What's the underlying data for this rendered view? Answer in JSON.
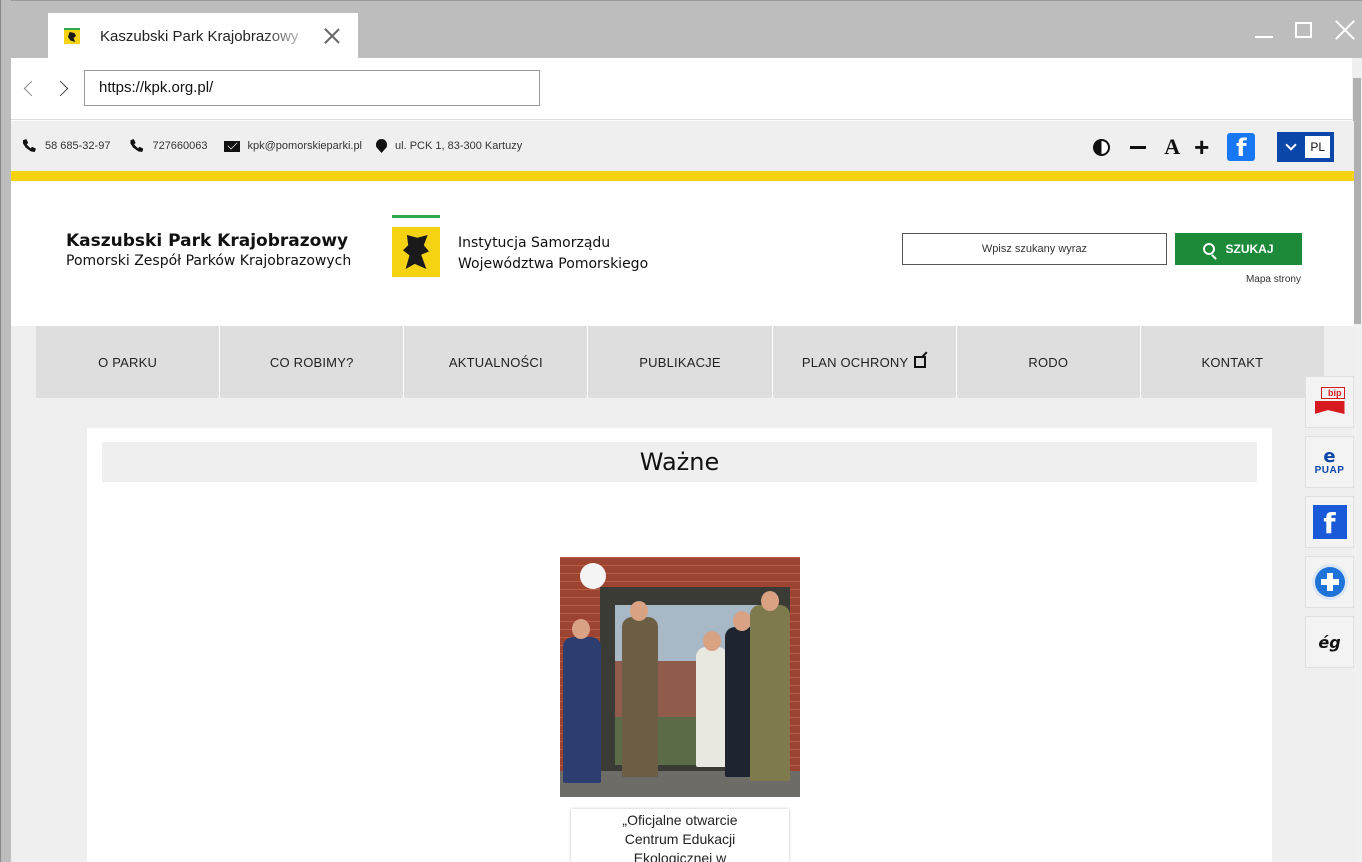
{
  "browser": {
    "tab_title": "Kaszubski Park Krajobrazowy",
    "url": "https://kpk.org.pl/"
  },
  "topbar": {
    "phone1": "58 685-32-97",
    "phone2": "727660063",
    "email": "kpk@pomorskieparki.pl",
    "address": "ul. PCK 1, 83-300 Kartuzy",
    "font_minus": "−",
    "font_a": "A",
    "font_plus": "+",
    "facebook": "f",
    "language": "PL"
  },
  "header": {
    "brand_title": "Kaszubski Park Krajobrazowy",
    "brand_subtitle": "Pomorski Zespół Parków Krajobrazowych",
    "institution_line1": "Instytucja Samorządu",
    "institution_line2": "Województwa Pomorskiego",
    "search_placeholder": "Wpisz szukany wyraz",
    "search_button": "SZUKAJ",
    "sitemap": "Mapa strony"
  },
  "menu": {
    "items": [
      {
        "label": "O PARKU"
      },
      {
        "label": "CO ROBIMY?"
      },
      {
        "label": "AKTUALNOŚCI"
      },
      {
        "label": "PUBLIKACJE"
      },
      {
        "label": "PLAN OCHRONY"
      },
      {
        "label": "RODO"
      },
      {
        "label": "KONTAKT"
      }
    ]
  },
  "main": {
    "section_title": "Ważne",
    "article": {
      "caption_line1": "„Oficjalne otwarcie",
      "caption_line2": "Centrum Edukacji",
      "caption_line3": "Ekologicznej w"
    }
  },
  "side_icons": {
    "bip_text": "bip",
    "puap_e": "e",
    "puap_text": "PUAP",
    "facebook": "f",
    "sign_text": "ég"
  },
  "colors": {
    "accent_yellow": "#f5d312",
    "search_green": "#1d8a3a",
    "lang_blue": "#0a47a8",
    "facebook_blue": "#1877f2",
    "bip_red": "#d71920"
  }
}
